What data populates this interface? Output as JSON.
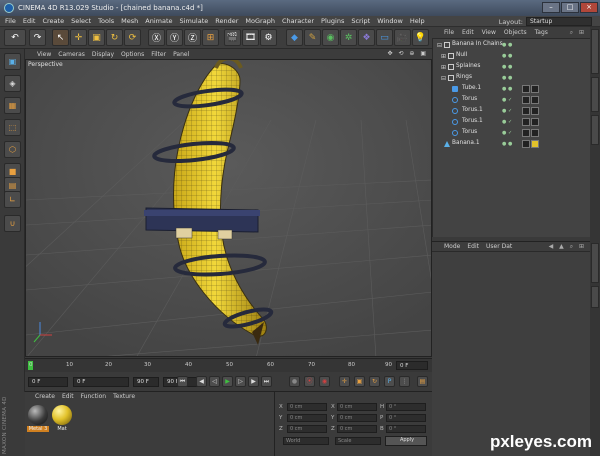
{
  "window": {
    "title": "CINEMA 4D R13.029 Studio - [chained banana.c4d *]"
  },
  "menubar": {
    "items": [
      "File",
      "Edit",
      "Create",
      "Select",
      "Tools",
      "Mesh",
      "Animate",
      "Simulate",
      "Render",
      "MoGraph",
      "Character",
      "Plugins",
      "Script",
      "Window",
      "Help"
    ],
    "layout_label": "Layout:",
    "layout_value": "Startup"
  },
  "viewport": {
    "menu": [
      "View",
      "Cameras",
      "Display",
      "Options",
      "Filter",
      "Panel"
    ],
    "label": "Perspective"
  },
  "timeline": {
    "ticks": [
      "0",
      "10",
      "20",
      "30",
      "40",
      "50",
      "60",
      "70",
      "80",
      "90"
    ],
    "current_frame": "0 F",
    "start_field": "0 F",
    "min_field": "0 F",
    "max_slider_field": "90 F",
    "end_field": "90 F"
  },
  "material_manager": {
    "menu": [
      "Create",
      "Edit",
      "Function",
      "Texture"
    ],
    "materials": [
      {
        "label": "Metal 3",
        "color": "#5a5a5a"
      },
      {
        "label": "Mat",
        "color": "#e2c22a"
      }
    ]
  },
  "coordinates": {
    "rows": [
      {
        "pos_axis": "X",
        "pos_value": "0 cm",
        "size_axis": "X",
        "size_value": "0 cm",
        "rot_axis": "H",
        "rot_value": "0 °"
      },
      {
        "pos_axis": "Y",
        "pos_value": "0 cm",
        "size_axis": "Y",
        "size_value": "0 cm",
        "rot_axis": "P",
        "rot_value": "0 °"
      },
      {
        "pos_axis": "Z",
        "pos_value": "0 cm",
        "size_axis": "Z",
        "size_value": "0 cm",
        "rot_axis": "B",
        "rot_value": "0 °"
      }
    ],
    "mode_select": "World",
    "scale_select": "Scale",
    "apply_label": "Apply"
  },
  "object_manager": {
    "menu": [
      "File",
      "Edit",
      "View",
      "Objects",
      "Tags"
    ],
    "objects": [
      {
        "name": "Banana In Chains",
        "depth": 0,
        "icon": "null-object-icon"
      },
      {
        "name": "Null",
        "depth": 1,
        "icon": "null-object-icon"
      },
      {
        "name": "Splaines",
        "depth": 1,
        "icon": "null-object-icon"
      },
      {
        "name": "Rings",
        "depth": 1,
        "icon": "null-object-icon"
      },
      {
        "name": "Tube.1",
        "depth": 2,
        "icon": "tube-icon"
      },
      {
        "name": "Torus",
        "depth": 2,
        "icon": "torus-icon"
      },
      {
        "name": "Torus.1",
        "depth": 2,
        "icon": "torus-icon"
      },
      {
        "name": "Torus.1",
        "depth": 2,
        "icon": "torus-icon"
      },
      {
        "name": "Torus",
        "depth": 2,
        "icon": "torus-icon"
      },
      {
        "name": "Banana.1",
        "depth": 1,
        "icon": "polygon-object-icon"
      }
    ]
  },
  "attribute_manager": {
    "menu": [
      "Mode",
      "Edit",
      "User Dat"
    ]
  },
  "branding": {
    "maxon_label": "MAXON CINEMA 4D"
  },
  "watermark": {
    "text": "pxleyes.com"
  },
  "colors": {
    "banana": "#e2c22a",
    "accent_blue": "#3b7fd6",
    "chain": "#2a2f4a"
  }
}
